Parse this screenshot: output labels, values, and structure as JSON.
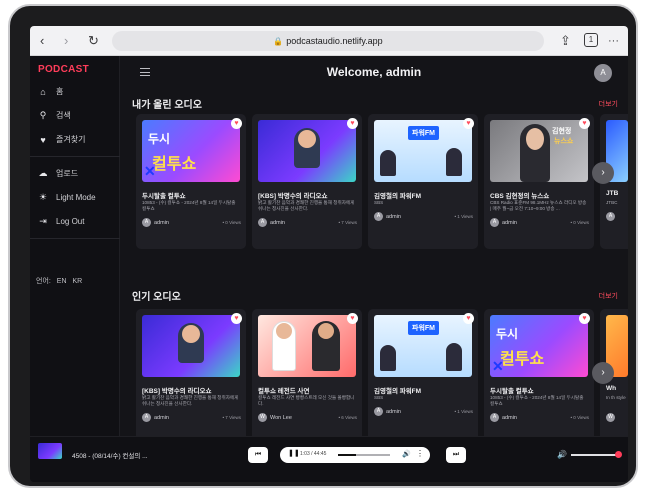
{
  "browser": {
    "url": "podcastaudio.netlify.app",
    "tab_count": "1",
    "back_icon": "chevron-left-icon",
    "forward_icon": "chevron-right-icon",
    "reload_icon": "reload-icon",
    "share_icon": "share-icon",
    "more_icon": "more-icon"
  },
  "app": {
    "logo": "PODCAST",
    "welcome": "Welcome, admin",
    "avatar_letter": "A",
    "accent": "#ff3d5a"
  },
  "sidebar": {
    "items": [
      {
        "label": "홈",
        "icon": "home-icon"
      },
      {
        "label": "검색",
        "icon": "search-icon"
      },
      {
        "label": "즐겨찾기",
        "icon": "heart-icon"
      },
      {
        "label": "업로드",
        "icon": "cloud-upload-icon"
      },
      {
        "label": "Light Mode",
        "icon": "sun-icon"
      },
      {
        "label": "Log Out",
        "icon": "logout-icon"
      }
    ],
    "language_label": "언어:",
    "languages": [
      "EN",
      "KR"
    ]
  },
  "sections": [
    {
      "title": "내가 올린 오디오",
      "more": "더보기",
      "cards": [
        {
          "title": "두시탈출 컬투쇼",
          "desc": "10853 - (수) 컬투쇼 - 2024년 8월 14일 두시탈출 컬투쇼",
          "user": "admin",
          "views": "• 0 Views"
        },
        {
          "title": "[KBS] 박명수의 라디오쇼",
          "desc": "밝고 활기찬 음악과 경쾌한 진행을 통해 청취자에게 쉬나는 청사진을 선사한다.",
          "user": "admin",
          "views": "• 7 Views"
        },
        {
          "title": "김영철의 파워FM",
          "desc": "SBS",
          "user": "admin",
          "views": "• 1 Views"
        },
        {
          "title": "CBS 김현정의 뉴스쇼",
          "desc": "CBS Radio 표준FM 98.1MHz 뉴스쇼 라디오 방송 | 매주 월~금 오전 7:10~9:00 방송 ...",
          "user": "admin",
          "views": "• 0 Views"
        },
        {
          "title": "JTB",
          "desc": "JTBC",
          "user": "A",
          "views": ""
        }
      ]
    },
    {
      "title": "인기 오디오",
      "more": "더보기",
      "cards": [
        {
          "title": "[KBS] 박명수의 라디오쇼",
          "desc": "밝고 활기찬 음악과 경쾌한 진행을 통해 청취자에게 쉬나는 청사진을 선사한다.",
          "user": "admin",
          "views": "• 7 Views"
        },
        {
          "title": "컬투쇼 레전드 사연",
          "desc": "컬투쇼 레전드 사연 빵빵스트레 모신 것들 몰빵합니다.",
          "user": "Won Lee",
          "views": "• 6 Views"
        },
        {
          "title": "김영철의 파워FM",
          "desc": "SBS",
          "user": "admin",
          "views": "• 1 Views"
        },
        {
          "title": "두시탈출 컬투쇼",
          "desc": "10853 - (수) 컬투쇼 - 2024년 8월 14일 두시탈출 컬투쇼",
          "user": "admin",
          "views": "• 0 Views"
        },
        {
          "title": "Wh",
          "desc": "In th style",
          "user": "W",
          "views": ""
        }
      ]
    }
  ],
  "player": {
    "title": "4508 - (08/14/수) 컨설의 ...",
    "time": "1:03 / 44:45",
    "progress_fraction": 0.05,
    "volume_fraction": 0.95
  }
}
